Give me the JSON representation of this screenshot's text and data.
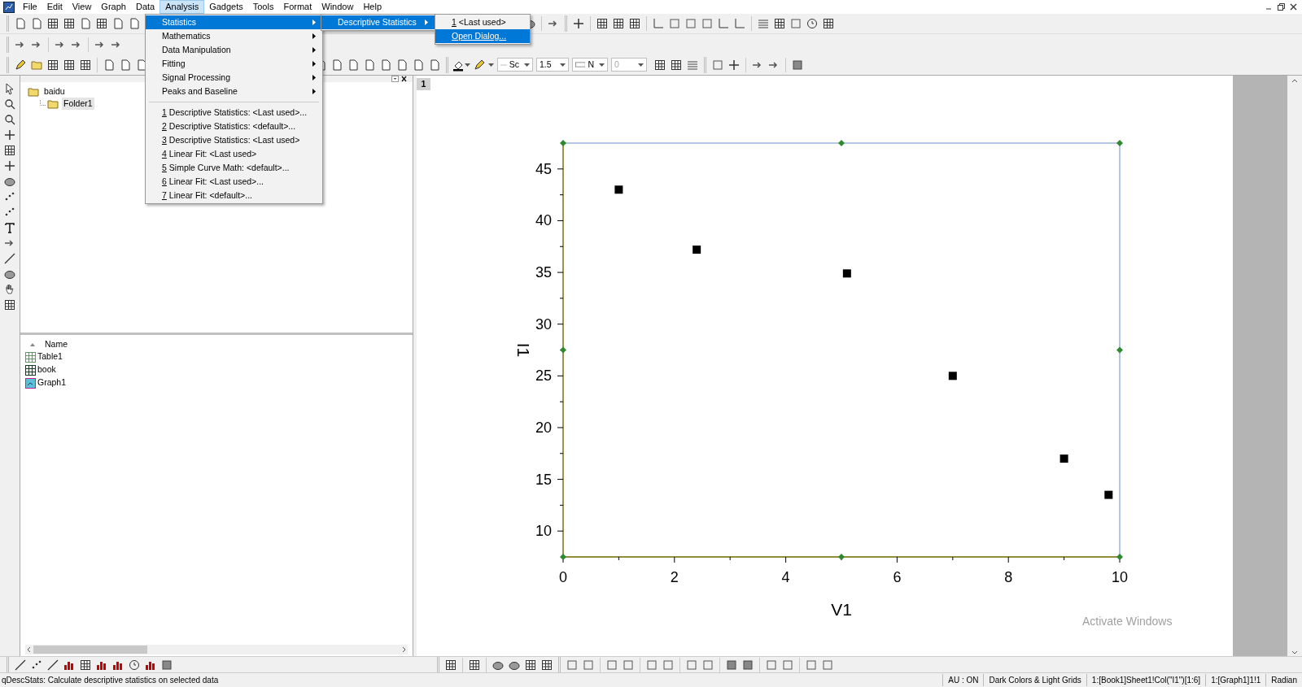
{
  "menubar": {
    "items": [
      {
        "label": "File",
        "selected": false
      },
      {
        "label": "Edit",
        "selected": false
      },
      {
        "label": "View",
        "selected": false
      },
      {
        "label": "Graph",
        "selected": false
      },
      {
        "label": "Data",
        "selected": false
      },
      {
        "label": "Analysis",
        "selected": true
      },
      {
        "label": "Gadgets",
        "selected": false
      },
      {
        "label": "Tools",
        "selected": false
      },
      {
        "label": "Format",
        "selected": false
      },
      {
        "label": "Window",
        "selected": false
      },
      {
        "label": "Help",
        "selected": false
      }
    ]
  },
  "analysis_menu": {
    "items": [
      {
        "kind": "submenu",
        "label": "Statistics",
        "selected": true
      },
      {
        "kind": "submenu",
        "label": "Mathematics",
        "selected": false
      },
      {
        "kind": "submenu",
        "label": "Data Manipulation",
        "selected": false
      },
      {
        "kind": "submenu",
        "label": "Fitting",
        "selected": false
      },
      {
        "kind": "submenu",
        "label": "Signal Processing",
        "selected": false
      },
      {
        "kind": "submenu",
        "label": "Peaks and Baseline",
        "selected": false
      },
      {
        "kind": "separator"
      },
      {
        "kind": "recent",
        "number": "1",
        "label": "Descriptive Statistics: <Last used>...",
        "selected": false
      },
      {
        "kind": "recent",
        "number": "2",
        "label": "Descriptive Statistics: <default>...",
        "selected": false
      },
      {
        "kind": "recent",
        "number": "3",
        "label": "Descriptive Statistics: <Last used>",
        "selected": false
      },
      {
        "kind": "recent",
        "number": "4",
        "label": "Linear Fit: <Last used>",
        "selected": false
      },
      {
        "kind": "recent",
        "number": "5",
        "label": "Simple Curve Math: <default>...",
        "selected": false
      },
      {
        "kind": "recent",
        "number": "6",
        "label": "Linear Fit: <Last used>...",
        "selected": false
      },
      {
        "kind": "recent",
        "number": "7",
        "label": "Linear Fit: <default>...",
        "selected": false
      }
    ]
  },
  "statistics_menu": {
    "items": [
      {
        "kind": "submenu",
        "label": "Descriptive Statistics",
        "selected": true
      }
    ]
  },
  "descriptive_menu": {
    "items": [
      {
        "kind": "recent",
        "number": "1",
        "label": "<Last used>",
        "selected": false
      },
      {
        "kind": "action",
        "label": "Open Dialog...",
        "selected": true
      }
    ]
  },
  "format_toolbar": {
    "fields": [
      {
        "value": "Sc",
        "disabled": false
      },
      {
        "value": "1.5",
        "disabled": false
      },
      {
        "value": "N",
        "disabled": false
      },
      {
        "value": "0",
        "disabled": true
      }
    ]
  },
  "project_explorer": {
    "tree": [
      {
        "label": "baidu",
        "selected": false,
        "children": [
          {
            "label": "Folder1",
            "selected": true
          }
        ]
      }
    ],
    "list": {
      "column": "Name",
      "items": [
        {
          "name": "Table1",
          "kind": "table"
        },
        {
          "name": "book",
          "kind": "workbook"
        },
        {
          "name": "Graph1",
          "kind": "graph"
        }
      ]
    }
  },
  "graph": {
    "page_number": "1",
    "activation_notice": "Activate Windows",
    "chart_data": {
      "type": "scatter",
      "xlabel": "V1",
      "ylabel": "I1",
      "xlim": [
        0,
        10
      ],
      "ylim": [
        7.5,
        47.5
      ],
      "xticks": [
        0,
        2,
        4,
        6,
        8,
        10
      ],
      "yticks": [
        10,
        15,
        20,
        25,
        30,
        35,
        40,
        45
      ],
      "series": [
        {
          "color": "#000000",
          "x": [
            1,
            2.4,
            5.1,
            7,
            9,
            9.8
          ],
          "values": [
            43,
            37.2,
            34.9,
            25,
            17,
            13.5
          ]
        }
      ]
    }
  },
  "status_bar": {
    "message": "qDescStats: Calculate descriptive statistics on selected data",
    "segments": [
      "AU : ON",
      "Dark Colors & Light Grids",
      "1:[Book1]Sheet1!Col(\"I1\")[1:6]",
      "1:[Graph1]1!1",
      "Radian"
    ]
  }
}
